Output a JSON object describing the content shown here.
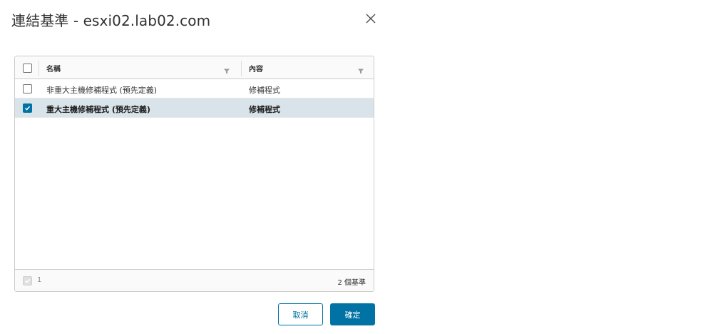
{
  "dialog": {
    "title": "連結基準 - esxi02.lab02.com",
    "close_icon": "close-icon"
  },
  "grid": {
    "columns": [
      {
        "label": "名稱",
        "filter_icon": "filter-icon"
      },
      {
        "label": "內容",
        "filter_icon": "filter-icon"
      }
    ],
    "rows": [
      {
        "name": "非重大主機修補程式 (預先定義)",
        "content": "修補程式",
        "selected": false
      },
      {
        "name": "重大主機修補程式 (預先定義)",
        "content": "修補程式",
        "selected": true
      }
    ],
    "footer": {
      "selected_count": "1",
      "total_label": "2 個基準"
    }
  },
  "buttons": {
    "cancel": "取消",
    "ok": "確定"
  },
  "colors": {
    "accent": "#0072a3",
    "selected_row": "#d9e4ea"
  }
}
